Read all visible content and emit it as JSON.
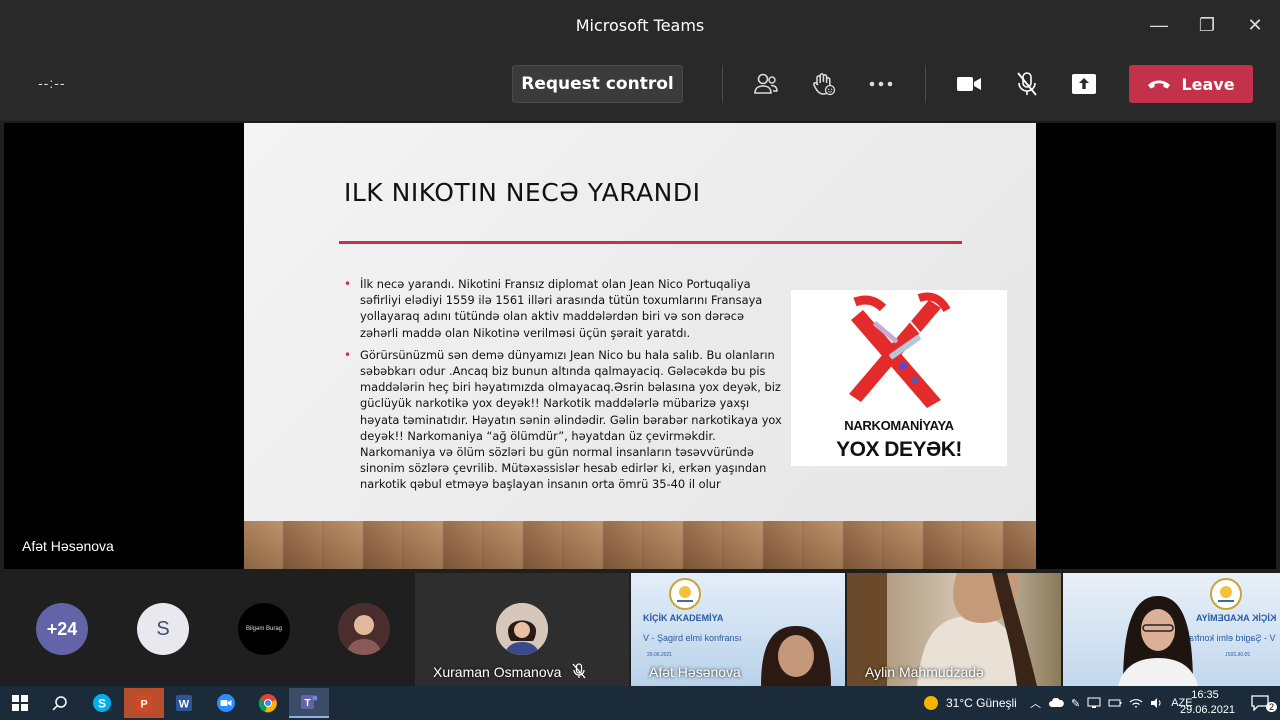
{
  "window": {
    "title": "Microsoft Teams",
    "minimize": "—",
    "maximize": "❐",
    "close": "✕"
  },
  "toolbar": {
    "timer": "--:--",
    "request_control": "Request control",
    "leave": "Leave"
  },
  "slide": {
    "title": "ILK NIKOTIN NECƏ YARANDI",
    "bullets": [
      "İlk necə yarandı. Nikotini Fransız diplomat olan Jean Nico Portuqaliya səfirliyi elədiyi 1559 ilə 1561 illəri arasında tütün toxumlarını Fransaya yollayaraq adını tütündə olan aktiv maddələrdən biri və son dərəcə zəhərli maddə olan Nikotinə verilməsi üçün şərait yaratdı.",
      " Görürsünüzmü sən demə dünyamızı Jean Nico bu hala salıb. Bu olanların səbəbkarı odur .Ancaq biz bunun altında qalmayaciq. Gələcəkdə bu pis maddələrin heç biri həyatımızda olmayacaq.Əsrin bəlasına yox deyək, biz güclüyük narkotikə yox deyək!! Narkotik maddələrlə mübarizə yaxşı həyata təminatıdır. Həyatın sənin əlindədir. Gəlin bərabər narkotikaya yox deyək!! Narkomaniya “ağ ölümdür”, həyatdan üz çevirməkdir. Narkomaniya və ölüm sözləri bu gün normal insanların təsəvvüründə sinonim sözlərə çevrilib. Mütəxəssislər hesab edirlər ki, erkən yaşından narkotik qəbul etməyə başlayan insanın orta ömrü 35-40 il olur"
    ],
    "poster_line1": "NARKOMANİYAYA",
    "poster_line2": "YOX DEYƏK!"
  },
  "stage": {
    "presenter_name": "Afət Həsənova"
  },
  "gallery": {
    "more_count": "+24",
    "avatar_s": "S",
    "tile_xuraman": "Xuraman Osmanova",
    "tile_afet": "Afət Həsənova",
    "tile_aylin": "Aylin Mahmudzadə",
    "banner_title": "KİÇİK AKADEMİYA",
    "banner_sub": "V - Şagird elmi konfransı",
    "banner_date": "29.06.2021",
    "banner_title_mirror": "KİÇİK AKADEMİYA",
    "banner_sub_mirror": "V - Şagird elmi konfransı",
    "banner_date_mirror": "29.06.2021",
    "black_avatar_text": "Bilgəm Burag"
  },
  "taskbar": {
    "weather": "31°C  Güneşli",
    "lang": "AZE",
    "time": "16:35",
    "date": "29.06.2021",
    "notif_count": "2"
  },
  "colors": {
    "accent_red": "#c4314b",
    "teams_purple": "#6264a7"
  }
}
